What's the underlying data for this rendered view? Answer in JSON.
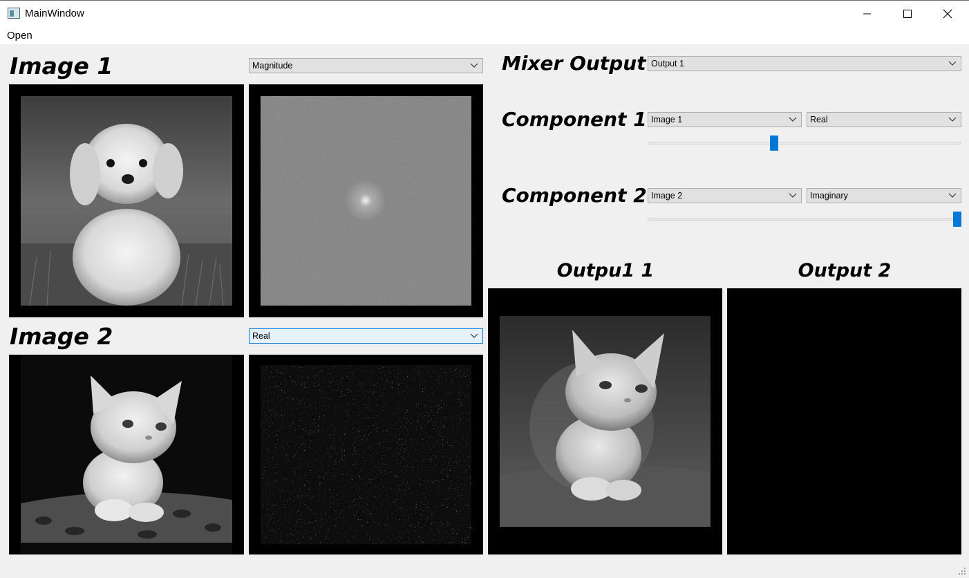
{
  "window": {
    "title": "MainWindow"
  },
  "menu": {
    "open_label": "Open"
  },
  "image1": {
    "title": "Image 1",
    "component_select": "Magnitude"
  },
  "image2": {
    "title": "Image 2",
    "component_select": "Real"
  },
  "mixer": {
    "output_title": "Mixer Output",
    "output_select": "Output 1",
    "component1": {
      "title": "Component 1",
      "image_select": "Image 1",
      "type_select": "Real",
      "slider_value": 0.4
    },
    "component2": {
      "title": "Component 2",
      "image_select": "Image 2",
      "type_select": "Imaginary",
      "slider_value": 1.0
    }
  },
  "outputs": {
    "output1_title": "Outpu1 1",
    "output2_title": "Output 2"
  },
  "colors": {
    "accent": "#0078d7",
    "panel_bg": "#000000",
    "window_bg": "#f0f0f0"
  }
}
